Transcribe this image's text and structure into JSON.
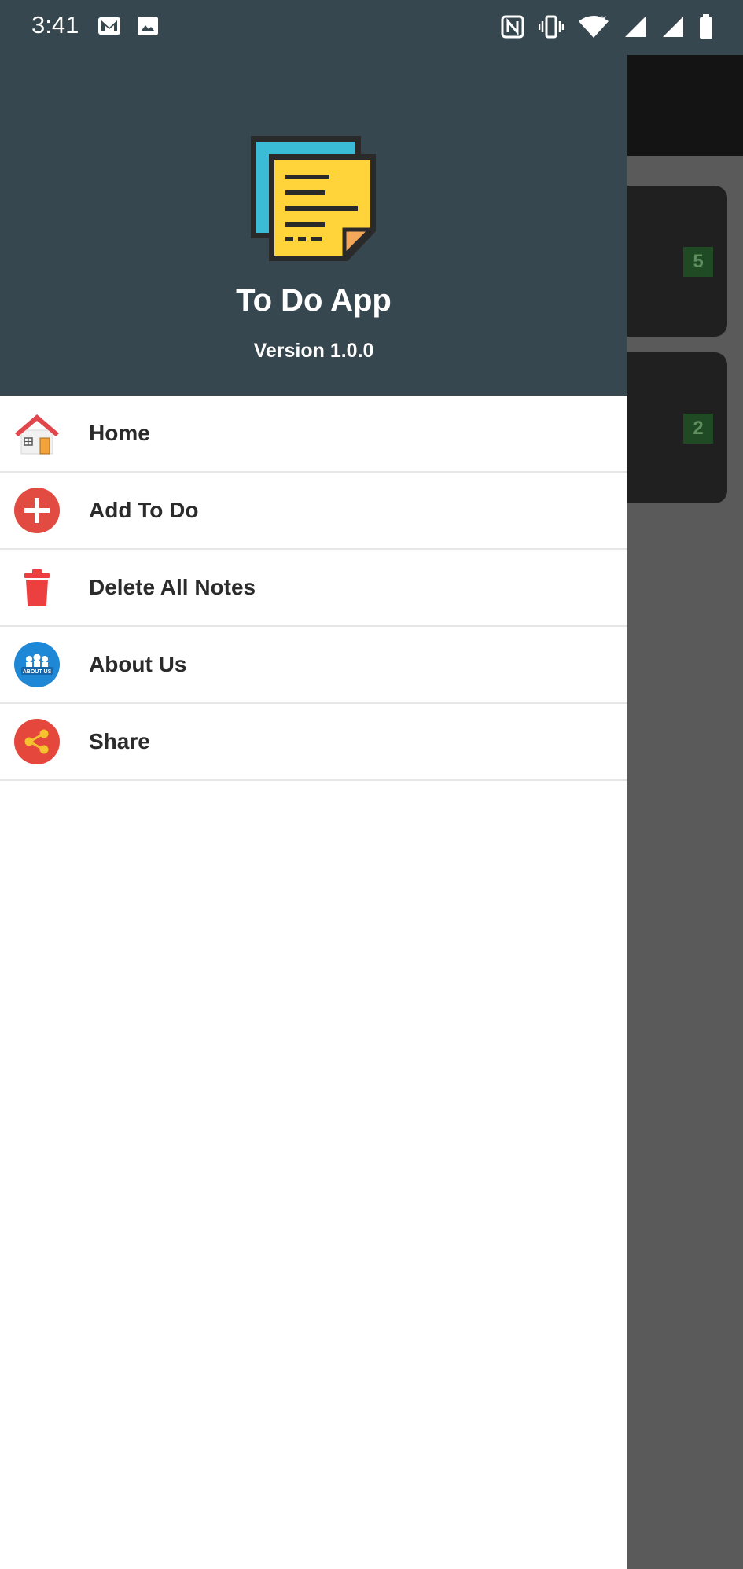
{
  "status_bar": {
    "time": "3:41",
    "left_icons": [
      "gmail-icon",
      "image-icon"
    ],
    "right_icons": [
      "nfc-icon",
      "vibrate-icon",
      "wifi-icon",
      "signal-icon",
      "signal-icon",
      "battery-icon"
    ]
  },
  "drawer": {
    "header": {
      "app_name": "To Do App",
      "version": "Version 1.0.0",
      "logo_icon": "sticky-notes-icon"
    },
    "menu": [
      {
        "label": "Home",
        "icon": "house-icon"
      },
      {
        "label": "Add To Do",
        "icon": "add-circle-icon"
      },
      {
        "label": "Delete All Notes",
        "icon": "trash-icon"
      },
      {
        "label": "About Us",
        "icon": "about-us-icon"
      },
      {
        "label": "Share",
        "icon": "share-icon"
      }
    ]
  },
  "background_cards": [
    {
      "badge": "5"
    },
    {
      "badge": "2"
    }
  ],
  "colors": {
    "header_bg": "#37474f",
    "drawer_bg": "#ffffff",
    "scrim": "#5a5a5a",
    "badge_bg": "#1f4a24"
  }
}
